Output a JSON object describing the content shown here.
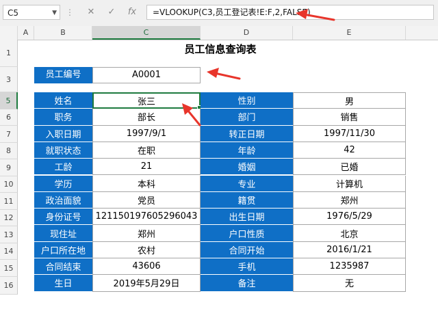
{
  "formula_bar": {
    "name_box": "C5",
    "cancel_glyph": "✕",
    "confirm_glyph": "✓",
    "fx_label": "fx",
    "formula": "=VLOOKUP(C3,员工登记表!E:F,2,FALSE)"
  },
  "columns": [
    "A",
    "B",
    "C",
    "D",
    "E"
  ],
  "rows": [
    "1",
    "3",
    "5",
    "6",
    "7",
    "8",
    "9",
    "10",
    "11",
    "12",
    "13",
    "14",
    "15",
    "16"
  ],
  "sheet": {
    "title": "员工信息查询表",
    "id_label": "员工编号",
    "id_value": "A0001",
    "info": [
      [
        "姓名",
        "张三",
        "性别",
        "男"
      ],
      [
        "职务",
        "部长",
        "部门",
        "销售"
      ],
      [
        "入职日期",
        "1997/9/1",
        "转正日期",
        "1997/11/30"
      ],
      [
        "就职状态",
        "在职",
        "年龄",
        "42"
      ],
      [
        "工龄",
        "21",
        "婚姻",
        "已婚"
      ],
      [
        "学历",
        "本科",
        "专业",
        "计算机"
      ],
      [
        "政治面貌",
        "党员",
        "籍贯",
        "郑州"
      ],
      [
        "身份证号",
        "121150197605296043",
        "出生日期",
        "1976/5/29"
      ],
      [
        "现住址",
        "郑州",
        "户口性质",
        "北京"
      ],
      [
        "户口所在地",
        "农村",
        "合同开始",
        "2016/1/21"
      ],
      [
        "合同结束",
        "43606",
        "手机",
        "1235987"
      ],
      [
        "生日",
        "2019年5月29日",
        "备注",
        "无"
      ]
    ]
  },
  "colors": {
    "label_blue": "#0f6fc6",
    "select_green": "#1d7a3e",
    "arrow_red": "#e8352b"
  },
  "icons": [
    "cancel-icon",
    "confirm-icon",
    "fx-icon",
    "arrow-icon"
  ]
}
